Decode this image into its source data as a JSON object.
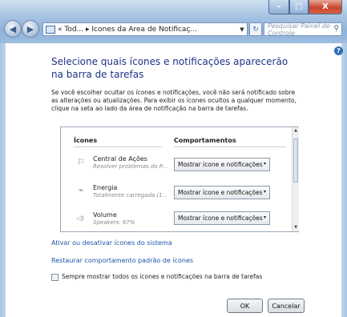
{
  "window": {
    "close_glyph": "X",
    "minimize_glyph": "–",
    "maximize_glyph": "□"
  },
  "toolbar": {
    "back_glyph": "◀",
    "forward_glyph": "▶",
    "address_text": "« Tod... ▸ Ícones da Área de Notificaç...",
    "address_dropdown_glyph": "▼",
    "refresh_glyph": "↻",
    "search_placeholder": "Pesquisar Painel de Controle",
    "search_glyph": "⚲"
  },
  "help_glyph": "?",
  "main": {
    "heading": "Selecione quais ícones e notificações aparecerão na barra de tarefas",
    "description": "Se você escolher ocultar os ícones e notificações, você não será notificado sobre as alterações ou atualizações. Para exibir os ícones ocultos a qualquer momento, clique na seta ao lado da área de notificação na barra de tarefas."
  },
  "table": {
    "columns": [
      "Ícones",
      "Comportamentos"
    ],
    "rows": [
      {
        "icon": "flag-icon",
        "glyph": "⚐",
        "name": "Central de Ações",
        "subtitle": "Resolver problemas do P...",
        "behavior": "Mostrar ícone e notificações"
      },
      {
        "icon": "power-icon",
        "glyph": "⌁",
        "name": "Energia",
        "subtitle": "Totalmente carregada (1...",
        "behavior": "Mostrar ícone e notificações"
      },
      {
        "icon": "speaker-icon",
        "glyph": "◁)",
        "name": "Volume",
        "subtitle": "Speakers: 67%",
        "behavior": "Mostrar ícone e notificações"
      }
    ],
    "dropdown_glyph": "▾",
    "scroll_up_glyph": "▲",
    "scroll_down_glyph": "▼"
  },
  "links": {
    "system_icons": "Ativar ou desativar ícones do sistema",
    "restore_defaults": "Restaurar comportamento padrão de ícones"
  },
  "always_show": {
    "label": "Sempre mostrar todos os ícones e notificações na barra de tarefas",
    "checked": false
  },
  "buttons": {
    "ok": "OK",
    "cancel": "Cancelar"
  },
  "colors": {
    "heading": "#1e3287",
    "link": "#1a56a8",
    "frame": "#a9c5e3",
    "close": "#c84630"
  }
}
